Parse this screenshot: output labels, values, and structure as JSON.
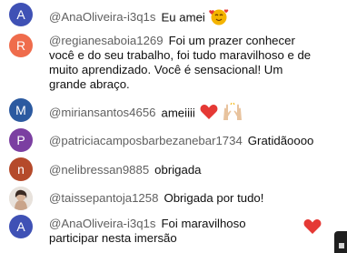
{
  "chat": {
    "messages": [
      {
        "avatar_letter": "A",
        "avatar_color": "#3f51b5",
        "author": "@AnaOliveira-i3q1s",
        "text": "Eu amei",
        "emoji": "smiling-face-with-hearts-icon"
      },
      {
        "avatar_letter": "R",
        "avatar_color": "#ef6c4c",
        "author": "@regianesaboia1269",
        "text": "Foi um prazer conhecer você e do seu trabalho, foi tudo maravilhoso e de muito aprendizado. Você é sensacional! Um grande abraço."
      },
      {
        "avatar_letter": "M",
        "avatar_color": "#2c5aa0",
        "author": "@miriansantos4656",
        "text": "ameiiii",
        "emoji": "red-heart-icon",
        "emoji2": "raising-hands-icon"
      },
      {
        "avatar_letter": "P",
        "avatar_color": "#7b3fa1",
        "author": "@patriciacamposbarbezanebar1734",
        "text": "Gratidãoooo"
      },
      {
        "avatar_letter": "n",
        "avatar_color": "#b54a2b",
        "author": "@nelibressan9885",
        "text": "obrigada"
      },
      {
        "avatar_letter": "",
        "avatar_color": "#e6e0da",
        "author": "@taissepantoja1258",
        "text": "Obrigada por tudo!"
      },
      {
        "avatar_letter": "A",
        "avatar_color": "#3f51b5",
        "author": "@AnaOliveira-i3q1s",
        "text": "Foi maravilhoso participar nesta imersão",
        "emoji": "red-heart-icon"
      }
    ]
  }
}
